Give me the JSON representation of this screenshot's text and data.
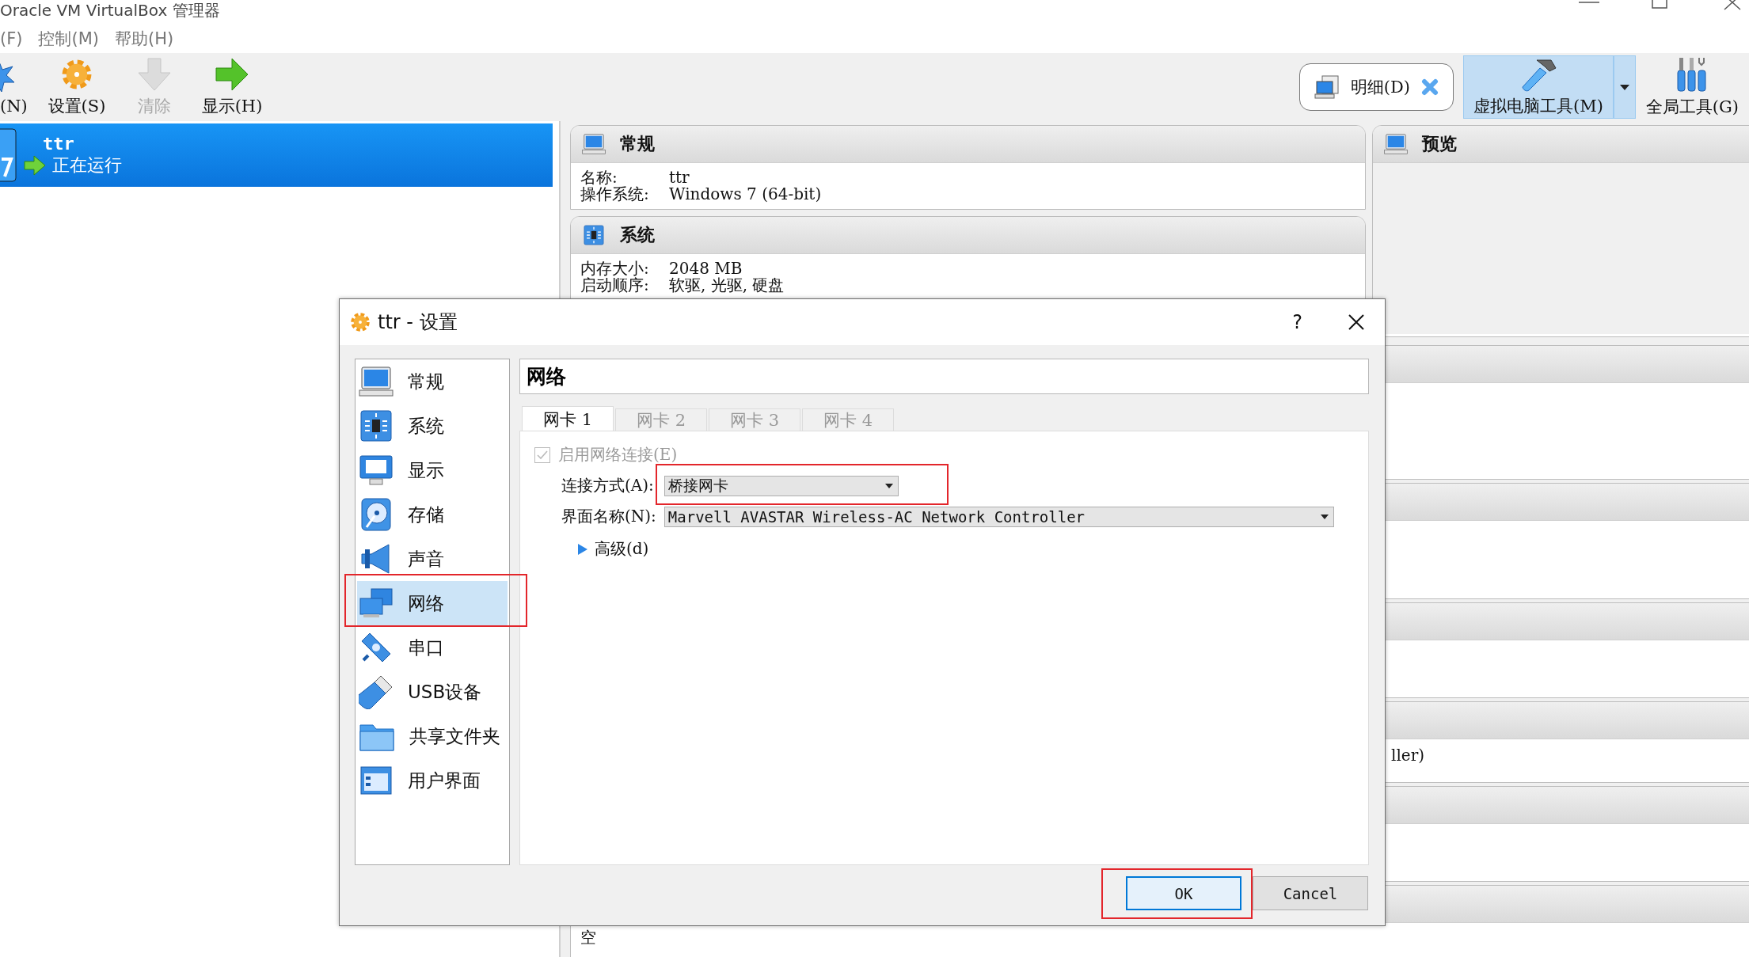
{
  "window": {
    "title": "Oracle VM VirtualBox 管理器"
  },
  "menu": [
    {
      "label": "(F)"
    },
    {
      "label": "控制(M)"
    },
    {
      "label": "帮助(H)"
    }
  ],
  "toolbar": {
    "actions": [
      {
        "kind": "new",
        "label": "(N)",
        "disabled": false
      },
      {
        "kind": "settings",
        "label": "设置(S)",
        "disabled": false
      },
      {
        "kind": "discard",
        "label": "清除",
        "disabled": true
      },
      {
        "kind": "show",
        "label": "显示(H)",
        "disabled": false
      }
    ],
    "details_button": {
      "label": "明细(D)"
    },
    "tools": [
      {
        "kind": "machine",
        "label": "虚拟电脑工具(M)",
        "selected": true
      },
      {
        "kind": "global",
        "label": "全局工具(G)",
        "selected": false
      }
    ]
  },
  "vm_list": [
    {
      "name": "ttr",
      "state": "正在运行",
      "selected": true
    }
  ],
  "details": {
    "sections": [
      {
        "kind": "general",
        "title": "常规",
        "rows": [
          {
            "label": "名称:",
            "value": "ttr"
          },
          {
            "label": "操作系统:",
            "value": "Windows 7 (64-bit)"
          }
        ]
      },
      {
        "kind": "system",
        "title": "系统",
        "rows": [
          {
            "label": "内存大小:",
            "value": "2048 MB"
          },
          {
            "label": "启动顺序:",
            "value": "软驱, 光驱, 硬盘"
          }
        ]
      }
    ],
    "preview": {
      "title": "预览"
    },
    "covered_sections": [
      {
        "kind": "covered"
      },
      {
        "kind": "covered"
      },
      {
        "kind": "covered"
      },
      {
        "kind": "covered",
        "tail": "ller)"
      },
      {
        "kind": "covered"
      },
      {
        "kind": "covered",
        "text": "空"
      }
    ]
  },
  "dialog": {
    "title": "ttr - 设置",
    "help": "?",
    "nav": [
      {
        "kind": "general",
        "label": "常规",
        "selected": false,
        "highlighted": false
      },
      {
        "kind": "system",
        "label": "系统",
        "selected": false,
        "highlighted": false
      },
      {
        "kind": "display",
        "label": "显示",
        "selected": false,
        "highlighted": false
      },
      {
        "kind": "storage",
        "label": "存储",
        "selected": false,
        "highlighted": false
      },
      {
        "kind": "audio",
        "label": "声音",
        "selected": false,
        "highlighted": false
      },
      {
        "kind": "network",
        "label": "网络",
        "selected": true,
        "highlighted": true
      },
      {
        "kind": "serial",
        "label": "串口",
        "selected": false,
        "highlighted": false
      },
      {
        "kind": "usb",
        "label": "USB设备",
        "selected": false,
        "highlighted": false
      },
      {
        "kind": "shared",
        "label": "共享文件夹",
        "selected": false,
        "highlighted": false
      },
      {
        "kind": "ui",
        "label": "用户界面",
        "selected": false,
        "highlighted": false
      }
    ],
    "page_title": "网络",
    "tabs": [
      {
        "label": "网卡 1",
        "selected": true
      },
      {
        "label": "网卡 2",
        "selected": false
      },
      {
        "label": "网卡 3",
        "selected": false
      },
      {
        "label": "网卡 4",
        "selected": false
      }
    ],
    "enable": {
      "label": "启用网络连接(E)",
      "checked": true,
      "disabled": true
    },
    "fields": [
      {
        "label": "连接方式(A):",
        "value": "桥接网卡",
        "highlighted": true
      },
      {
        "label": "界面名称(N):",
        "value": "Marvell AVASTAR Wireless-AC Network Controller",
        "highlighted": false
      }
    ],
    "advanced": {
      "label": "高级(d)",
      "expanded": false
    },
    "buttons": [
      {
        "label": "OK",
        "default": true,
        "highlighted": true
      },
      {
        "label": "Cancel",
        "default": false,
        "highlighted": false
      }
    ]
  }
}
